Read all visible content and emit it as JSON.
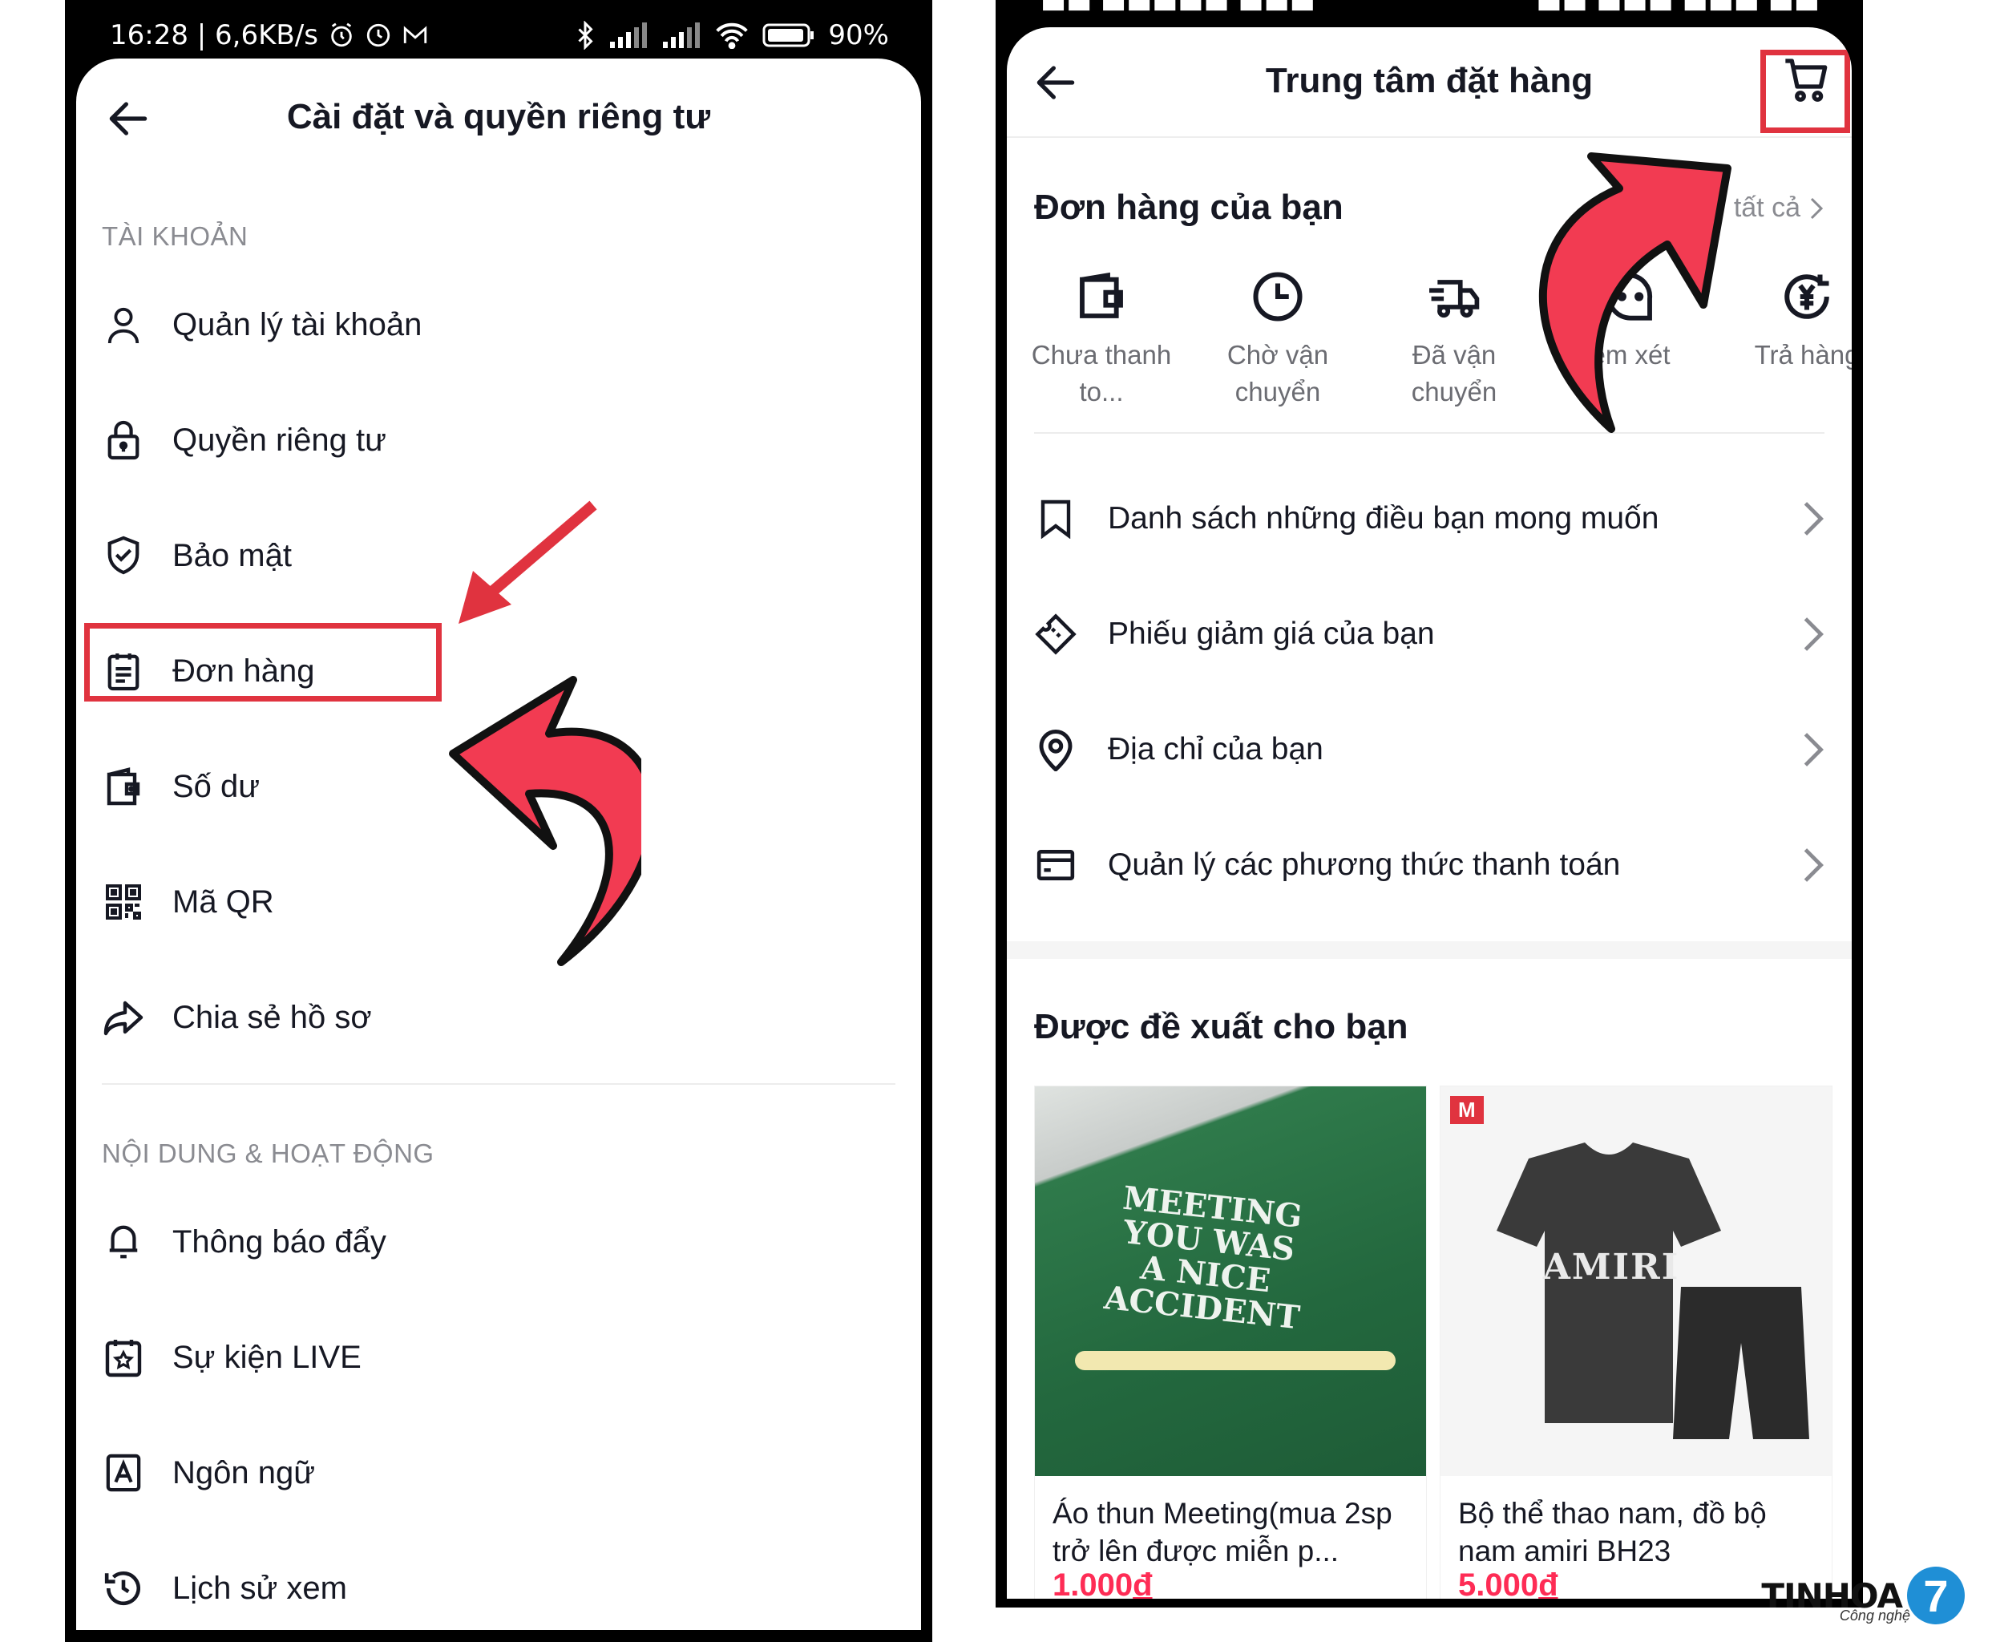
{
  "left": {
    "status": {
      "time_speed": "16:28 | 6,6KB/s",
      "battery": "90%"
    },
    "title": "Cài đặt và quyền riêng tư",
    "section_account": "TÀI KHOẢN",
    "section_content": "NỘI DUNG & HOẠT ĐỘNG",
    "items": [
      {
        "label": "Quản lý tài khoản",
        "icon": "person-icon"
      },
      {
        "label": "Quyền riêng tư",
        "icon": "lock-icon"
      },
      {
        "label": "Bảo mật",
        "icon": "shield-icon"
      },
      {
        "label": "Đơn hàng",
        "icon": "order-list-icon"
      },
      {
        "label": "Số dư",
        "icon": "wallet-icon"
      },
      {
        "label": "Mã QR",
        "icon": "qr-code-icon"
      },
      {
        "label": "Chia sẻ hồ sơ",
        "icon": "share-icon"
      }
    ],
    "content_items": [
      {
        "label": "Thông báo đẩy",
        "icon": "bell-icon"
      },
      {
        "label": "Sự kiện LIVE",
        "icon": "calendar-star-icon"
      },
      {
        "label": "Ngôn ngữ",
        "icon": "language-icon"
      },
      {
        "label": "Lịch sử xem",
        "icon": "history-icon"
      }
    ]
  },
  "right": {
    "title": "Trung tâm đặt hàng",
    "orders_title": "Đơn hàng của bạn",
    "see_all": "tất cả",
    "statuses": [
      {
        "label": "Chưa thanh to...",
        "icon": "wallet-icon"
      },
      {
        "label": "Chờ vận chuyển",
        "icon": "clock-icon"
      },
      {
        "label": "Đã vận chuyển",
        "icon": "truck-icon"
      },
      {
        "label": "em xét",
        "icon": "review-icon"
      },
      {
        "label": "Trả hàng",
        "icon": "refund-icon"
      }
    ],
    "list": [
      {
        "label": "Danh sách những điều bạn mong muốn",
        "icon": "bookmark-icon"
      },
      {
        "label": "Phiếu giảm giá của bạn",
        "icon": "coupon-icon"
      },
      {
        "label": "Địa chỉ của bạn",
        "icon": "location-icon"
      },
      {
        "label": "Quản lý các phương thức thanh toán",
        "icon": "card-icon"
      }
    ],
    "recommend_title": "Được đề xuất cho bạn",
    "products": [
      {
        "name": "Áo thun Meeting(mua 2sp trở lên được miễn p...",
        "price": "1.000",
        "currency": "đ",
        "image_text": "MEETING YOU WAS A NICE ACCIDENT"
      },
      {
        "name": "Bộ thể thao nam, đồ bộ nam amiri BH23",
        "price": "5.000",
        "currency": "đ",
        "image_text": "AMIRI",
        "brand_tag": "M"
      }
    ]
  },
  "watermark": {
    "text": "TINHOA",
    "sub": "Công nghệ",
    "number": "7"
  },
  "colors": {
    "accent_red": "#e0333f",
    "arrow_fill": "#f23b52",
    "price": "#fe2c55"
  }
}
